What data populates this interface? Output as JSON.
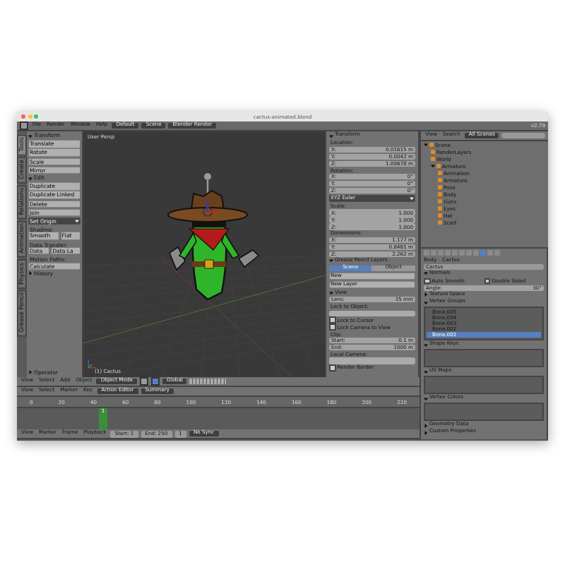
{
  "window": {
    "title": "cactus-animated.blend"
  },
  "top_bar": {
    "menus": [
      "File",
      "Render",
      "Window",
      "Help"
    ],
    "layout": "Default",
    "scene": "Scene",
    "engine": "Blender Render",
    "stats": "v2.79"
  },
  "toolshelf": {
    "tabs": [
      {
        "label": "Tools",
        "selected": true
      },
      {
        "label": "Create",
        "selected": false
      },
      {
        "label": "Relations",
        "selected": false
      },
      {
        "label": "Animation",
        "selected": false
      },
      {
        "label": "Physics",
        "selected": false
      },
      {
        "label": "Grease Pencil",
        "selected": false
      }
    ],
    "items": [
      {
        "kind": "header",
        "label": "Transform",
        "expanded": true
      },
      {
        "kind": "button",
        "label": "Translate"
      },
      {
        "kind": "button",
        "label": "Rotate"
      },
      {
        "kind": "button",
        "label": "Scale"
      },
      {
        "kind": "button",
        "label": "Mirror"
      },
      {
        "kind": "header",
        "label": "Edit",
        "expanded": true
      },
      {
        "kind": "button",
        "label": "Duplicate"
      },
      {
        "kind": "button",
        "label": "Duplicate Linked"
      },
      {
        "kind": "button",
        "label": "Delete"
      },
      {
        "kind": "button",
        "label": "Join"
      },
      {
        "kind": "dropdown",
        "label": "Set Origin"
      },
      {
        "kind": "label",
        "label": "Shading:"
      },
      {
        "kind": "buttons",
        "labels": [
          "Smooth",
          "Flat"
        ]
      },
      {
        "kind": "label",
        "label": "Data Transfer:"
      },
      {
        "kind": "buttons",
        "labels": [
          "Data",
          "Data La"
        ]
      },
      {
        "kind": "label",
        "label": "Motion Paths:"
      },
      {
        "kind": "button",
        "label": "Calculate"
      },
      {
        "kind": "header",
        "label": "History",
        "expanded": false
      },
      {
        "kind": "spacer"
      },
      {
        "kind": "header",
        "label": "Operator",
        "expanded": false
      }
    ]
  },
  "viewport": {
    "view_label": "User Persp",
    "object_label": "(1) Cactus"
  },
  "viewport_header": {
    "menus": [
      "View",
      "Select",
      "Add",
      "Object"
    ],
    "mode": "Object Mode",
    "orientation": "Global"
  },
  "n_panel": {
    "items": [
      {
        "kind": "header",
        "label": "Transform",
        "expanded": true
      },
      {
        "kind": "label",
        "label": "Location:"
      },
      {
        "kind": "field",
        "label": "X:",
        "value": "0.01615 m"
      },
      {
        "kind": "field",
        "label": "Y:",
        "value": "0.0042 m"
      },
      {
        "kind": "field",
        "label": "Z:",
        "value": "1.00678 m"
      },
      {
        "kind": "label",
        "label": "Rotation:"
      },
      {
        "kind": "field",
        "label": "X:",
        "value": "0°"
      },
      {
        "kind": "field",
        "label": "Y:",
        "value": "0°"
      },
      {
        "kind": "field",
        "label": "Z:",
        "value": "0°"
      },
      {
        "kind": "dropdown",
        "label": "XYZ Euler"
      },
      {
        "kind": "label",
        "label": "Scale:"
      },
      {
        "kind": "field",
        "label": "X:",
        "value": "1.000"
      },
      {
        "kind": "field",
        "label": "Y:",
        "value": "1.000"
      },
      {
        "kind": "field",
        "label": "Z:",
        "value": "1.000"
      },
      {
        "kind": "label",
        "label": "Dimensions:"
      },
      {
        "kind": "field",
        "label": "X:",
        "value": "1.177 m"
      },
      {
        "kind": "field",
        "label": "Y:",
        "value": "0.8481 m"
      },
      {
        "kind": "field",
        "label": "Z:",
        "value": "2.262 m"
      },
      {
        "kind": "header",
        "label": "Grease Pencil Layers",
        "expanded": true
      },
      {
        "kind": "tabs",
        "tabs": [
          {
            "label": "Scene",
            "selected": true
          },
          {
            "label": "Object",
            "selected": false
          }
        ]
      },
      {
        "kind": "button",
        "label": "New"
      },
      {
        "kind": "button",
        "label": "New Layer"
      },
      {
        "kind": "header",
        "label": "View",
        "expanded": true
      },
      {
        "kind": "field",
        "label": "Lens:",
        "value": "35 mm"
      },
      {
        "kind": "label",
        "label": "Lock to Object:"
      },
      {
        "kind": "object_field"
      },
      {
        "kind": "checkbox",
        "label": "Lock to Cursor",
        "checked": false
      },
      {
        "kind": "checkbox",
        "label": "Lock Camera to View",
        "checked": false
      },
      {
        "kind": "label",
        "label": "Clip:"
      },
      {
        "kind": "field",
        "label": "Start:",
        "value": "0.1 m"
      },
      {
        "kind": "field",
        "label": "End:",
        "value": "1000 m"
      },
      {
        "kind": "label",
        "label": "Local Camera:"
      },
      {
        "kind": "object_field"
      },
      {
        "kind": "checkbox",
        "label": "Render Border",
        "checked": false
      }
    ]
  },
  "outliner": {
    "menus": [
      "View",
      "Search"
    ],
    "filter": "All Scenes",
    "tree": [
      {
        "label": "Scene",
        "expanded": true,
        "children": [
          {
            "label": "RenderLayers"
          },
          {
            "label": "World"
          },
          {
            "label": "Armature",
            "expanded": true,
            "children": [
              {
                "label": "Animation"
              },
              {
                "label": "Armature"
              },
              {
                "label": "Pose"
              },
              {
                "label": "Body"
              },
              {
                "label": "Guns"
              },
              {
                "label": "Eyes"
              },
              {
                "label": "Hat"
              },
              {
                "label": "Scarf"
              }
            ]
          }
        ]
      }
    ]
  },
  "properties": {
    "items": [
      {
        "kind": "icon_row"
      },
      {
        "kind": "breadcrumb",
        "parts": [
          "Body",
          "Cactus"
        ]
      },
      {
        "kind": "name_field",
        "label": "Cactus"
      },
      {
        "kind": "header",
        "label": "Normals",
        "expanded": true
      },
      {
        "kind": "checkbox_pair",
        "items": [
          {
            "label": "Auto Smooth",
            "checked": false
          },
          {
            "label": "Double Sided",
            "checked": false
          }
        ]
      },
      {
        "kind": "field",
        "label": "Angle:",
        "value": "30°"
      },
      {
        "kind": "header",
        "label": "Texture Space",
        "expanded": false
      },
      {
        "kind": "header",
        "label": "Vertex Groups",
        "expanded": true
      },
      {
        "kind": "list",
        "rows": [
          {
            "label": "Bone.005",
            "selected": false
          },
          {
            "label": "Bone.004",
            "selected": false
          },
          {
            "label": "Bone.003",
            "selected": false
          },
          {
            "label": "Bone.002",
            "selected": false
          },
          {
            "label": "Bone.001",
            "selected": true
          }
        ]
      },
      {
        "kind": "header",
        "label": "Shape Keys",
        "expanded": true
      },
      {
        "kind": "empty_list"
      },
      {
        "kind": "header",
        "label": "UV Maps",
        "expanded": true
      },
      {
        "kind": "empty_list"
      },
      {
        "kind": "header",
        "label": "Vertex Colors",
        "expanded": true
      },
      {
        "kind": "empty_list"
      },
      {
        "kind": "header",
        "label": "Geometry Data",
        "expanded": false
      },
      {
        "kind": "header",
        "label": "Custom Properties",
        "expanded": false
      }
    ]
  },
  "dopesheet_header": {
    "menus": [
      "View",
      "Select",
      "Marker",
      "Key"
    ],
    "mode": "Action Editor",
    "summary": "Summary"
  },
  "timeline": {
    "ruler": [
      "0",
      "20",
      "40",
      "60",
      "80",
      "100",
      "120",
      "140",
      "160",
      "180",
      "200",
      "220"
    ],
    "current_frame": "1"
  },
  "timeline_header": {
    "menus": [
      "View",
      "Marker",
      "Frame",
      "Playback"
    ],
    "start": "Start: 1",
    "end": "End: 250",
    "frame": "1",
    "sync": "No Sync"
  }
}
